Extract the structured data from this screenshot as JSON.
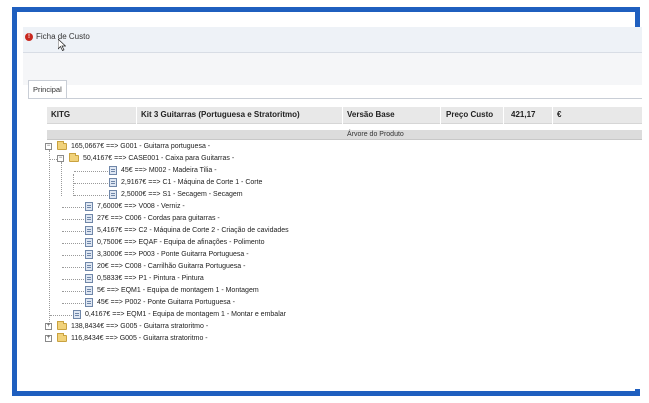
{
  "window": {
    "title": "Ficha de Custo"
  },
  "tabs": [
    {
      "label": "Principal"
    }
  ],
  "header": {
    "code": "KITG",
    "description": "Kit 3 Guitarras (Portuguesa e Stratoritmo)",
    "version_label": "Versão Base",
    "cost_label": "Preço Custo",
    "cost_value": "421,17",
    "currency": "€"
  },
  "tree": {
    "title": "Árvore do Produto",
    "nodes": [
      {
        "label": "165,0667€ ==> G001 - Guitarra portuguesa -",
        "icon": "folder-icon",
        "expander": "−"
      },
      {
        "label": "50,4167€ ==> CASE001 - Caixa para Guitarras -",
        "icon": "folder-icon",
        "expander": "−"
      },
      {
        "label": "45€ ==> M002 - Madeira Tilia -",
        "icon": "doc-icon"
      },
      {
        "label": "2,9167€ ==> C1 - Máquina de Corte 1 - Corte",
        "icon": "doc-icon"
      },
      {
        "label": "2,5000€ ==> S1 - Secagem - Secagem",
        "icon": "doc-icon"
      },
      {
        "label": "7,6000€ ==> V008 - Verniz -",
        "icon": "doc-icon"
      },
      {
        "label": "27€ ==> C006 - Cordas para guitarras -",
        "icon": "doc-icon"
      },
      {
        "label": "5,4167€ ==> C2 - Máquina de Corte 2 - Criação de cavidades",
        "icon": "doc-icon"
      },
      {
        "label": "0,7500€ ==> EQAF - Equipa de afinações - Polimento",
        "icon": "doc-icon"
      },
      {
        "label": "3,3000€ ==> P003 - Ponte Guitarra Portuguesa -",
        "icon": "doc-icon"
      },
      {
        "label": "20€ ==> C008 - Carrilhão Guitarra Portuguesa -",
        "icon": "doc-icon"
      },
      {
        "label": "0,5833€ ==> P1 - Pintura - Pintura",
        "icon": "doc-icon"
      },
      {
        "label": "5€ ==> EQM1 - Equipa de montagem 1 - Montagem",
        "icon": "doc-icon"
      },
      {
        "label": "45€ ==> P002 - Ponte Guitarra Portuguesa -",
        "icon": "doc-icon"
      },
      {
        "label": "0,4167€ ==> EQM1 - Equipa de montagem 1 - Montar e embalar",
        "icon": "doc-icon"
      },
      {
        "label": "138,8434€ ==> G005 - Guitarra stratoritmo -",
        "icon": "folder-icon",
        "expander": "+"
      },
      {
        "label": "116,8434€ ==> G005 - Guitarra stratoritmo -",
        "icon": "folder-icon",
        "expander": "+"
      }
    ]
  }
}
